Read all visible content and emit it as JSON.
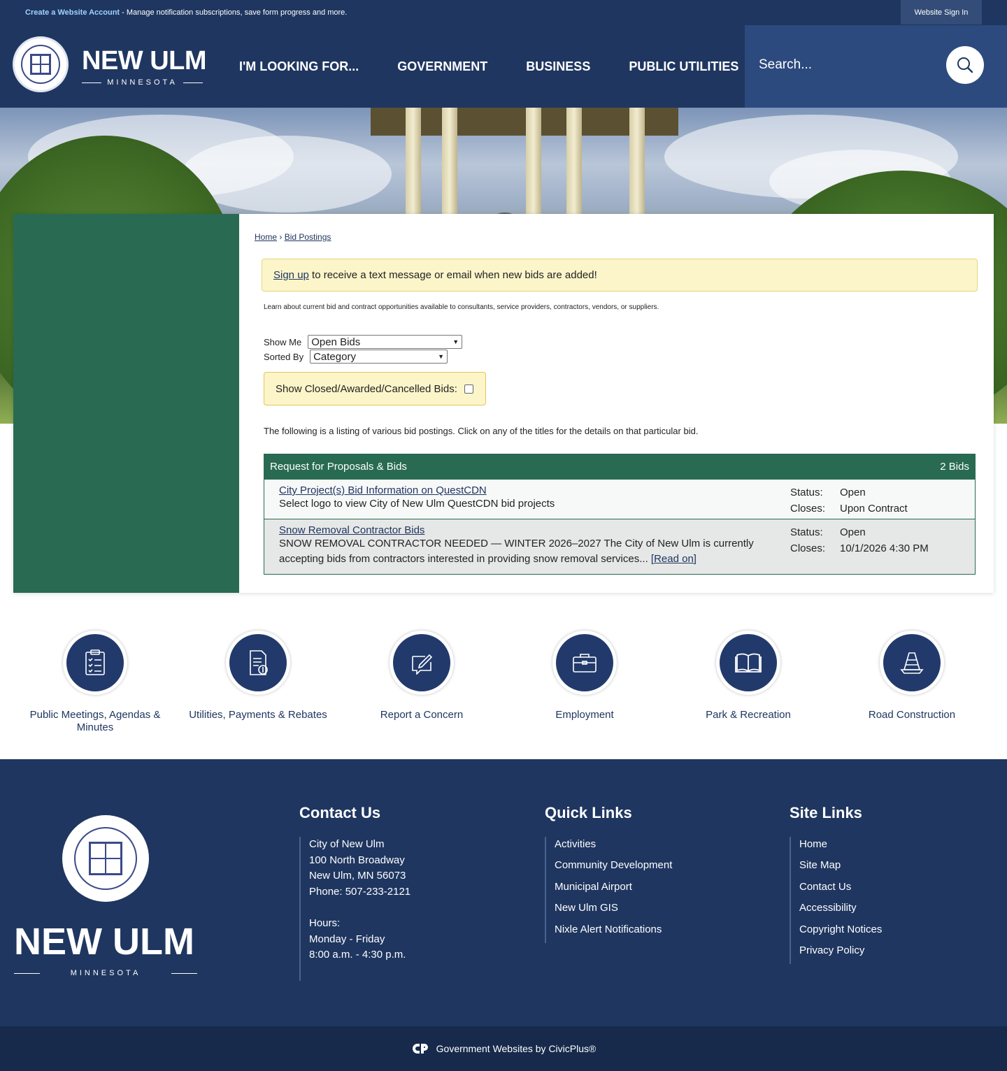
{
  "topbar": {
    "account_link": "Create a Website Account",
    "account_text": " - Manage notification subscriptions, save form progress and more.",
    "sign_in": "Website Sign In"
  },
  "header": {
    "brand_title": "NEW ULM",
    "brand_sub": "MINNESOTA",
    "nav": [
      "I'M LOOKING FOR...",
      "GOVERNMENT",
      "BUSINESS",
      "PUBLIC UTILITIES"
    ],
    "search_placeholder": "Search..."
  },
  "breadcrumb": {
    "home": "Home",
    "sep": "›",
    "current": "Bid Postings"
  },
  "alert": {
    "link": "Sign up",
    "text": " to receive a text message or email when new bids are added!"
  },
  "intro": "Learn about current bid and contract opportunities available to consultants, service providers, contractors, vendors, or suppliers.",
  "filters": {
    "show_me_label": "Show Me",
    "show_me_value": "Open Bids",
    "sorted_by_label": "Sorted By",
    "sorted_by_value": "Category",
    "closed_label": "Show Closed/Awarded/Cancelled Bids:"
  },
  "listing_note": "The following is a listing of various bid postings. Click on any of the titles for the details on that particular bid.",
  "bids": {
    "category": "Request for Proposals & Bids",
    "count": "2 Bids",
    "items": [
      {
        "title": "City Project(s) Bid Information on QuestCDN",
        "desc": "Select logo to view City of New Ulm QuestCDN bid projects",
        "read_on": "",
        "status_label": "Status:",
        "status": "Open",
        "closes_label": "Closes:",
        "closes": "Upon Contract"
      },
      {
        "title": "Snow Removal Contractor Bids",
        "desc": "SNOW REMOVAL CONTRACTOR NEEDED — WINTER 2026–2027 The City of New Ulm is currently accepting bids from contractors interested in providing snow removal services... ",
        "read_on": "[Read on]",
        "status_label": "Status:",
        "status": "Open",
        "closes_label": "Closes:",
        "closes": "10/1/2026 4:30 PM"
      }
    ]
  },
  "quick_links": [
    {
      "label": "Public Meetings, Agendas & Minutes",
      "icon": "clipboard-checklist-icon"
    },
    {
      "label": "Utilities, Payments & Rebates",
      "icon": "bill-dollar-icon"
    },
    {
      "label": "Report a Concern",
      "icon": "pencil-note-icon"
    },
    {
      "label": "Employment",
      "icon": "briefcase-icon"
    },
    {
      "label": "Park & Recreation",
      "icon": "open-book-icon"
    },
    {
      "label": "Road Construction",
      "icon": "traffic-cone-icon"
    }
  ],
  "footer": {
    "brand_title": "NEW ULM",
    "brand_sub": "MINNESOTA",
    "contact": {
      "heading": "Contact Us",
      "lines": [
        "City of New Ulm",
        "100 North Broadway",
        "New Ulm, MN 56073",
        "Phone: 507-233-2121"
      ],
      "hours_label": "Hours:",
      "hours": [
        "Monday - Friday",
        "8:00 a.m. - 4:30 p.m."
      ]
    },
    "quick_links": {
      "heading": "Quick Links",
      "items": [
        "Activities",
        "Community Development",
        "Municipal Airport",
        "New Ulm GIS",
        "Nixle Alert Notifications"
      ]
    },
    "site_links": {
      "heading": "Site Links",
      "items": [
        "Home",
        "Site Map",
        "Contact Us",
        "Accessibility",
        "Copyright Notices",
        "Privacy Policy"
      ]
    },
    "credit": "Government Websites by CivicPlus®"
  },
  "colors": {
    "navy": "#1f3660",
    "green": "#286b52",
    "alert_bg": "#fcf5c9"
  }
}
